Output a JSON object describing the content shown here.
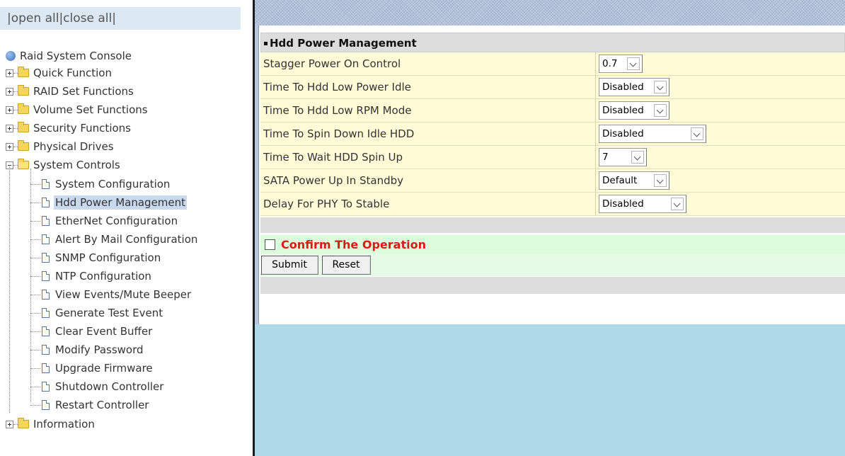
{
  "left": {
    "open_all": "open all",
    "close_all": "close all",
    "sep": "|",
    "root": "Raid System Console",
    "folders": [
      {
        "label": "Quick Function"
      },
      {
        "label": "RAID Set Functions"
      },
      {
        "label": "Volume Set Functions"
      },
      {
        "label": "Security Functions"
      },
      {
        "label": "Physical Drives"
      },
      {
        "label": "System Controls"
      }
    ],
    "system_controls_items": [
      "System Configuration",
      "Hdd Power Management",
      "EtherNet Configuration",
      "Alert By Mail Configuration",
      "SNMP Configuration",
      "NTP Configuration",
      "View Events/Mute Beeper",
      "Generate Test Event",
      "Clear Event Buffer",
      "Modify Password",
      "Upgrade Firmware",
      "Shutdown Controller",
      "Restart Controller"
    ],
    "selected_item": "Hdd Power Management",
    "information": "Information"
  },
  "panel": {
    "title": "Hdd Power Management",
    "rows": [
      {
        "label": "Stagger Power On Control",
        "value": "0.7"
      },
      {
        "label": "Time To Hdd Low Power Idle",
        "value": "Disabled"
      },
      {
        "label": "Time To Hdd Low RPM Mode",
        "value": "Disabled"
      },
      {
        "label": "Time To Spin Down Idle HDD",
        "value": "Disabled"
      },
      {
        "label": "Time To Wait HDD Spin Up",
        "value": "7"
      },
      {
        "label": "SATA Power Up In Standby",
        "value": "Default"
      },
      {
        "label": "Delay For PHY To Stable",
        "value": "Disabled"
      }
    ],
    "confirm_label": "Confirm The Operation",
    "submit_label": "Submit",
    "reset_label": "Reset"
  },
  "colors": {
    "accent_red": "#e01818",
    "form_row_bg": "#fffbd6",
    "confirm_bg": "#dcfcdc",
    "right_bg": "#afd8e8"
  }
}
